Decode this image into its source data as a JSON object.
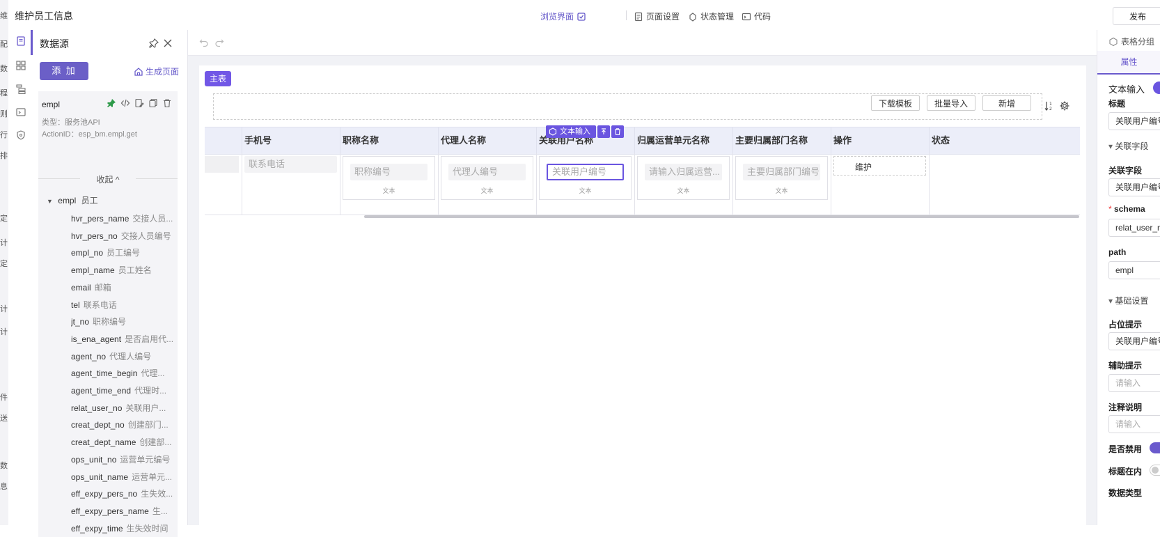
{
  "app": {
    "title": "维护员工信息",
    "publish": "发布"
  },
  "header": {
    "preview": "浏览界面",
    "page_settings": "页面设置",
    "state_mgmt": "状态管理",
    "code": "代码"
  },
  "edge_chars": [
    "维",
    "配",
    "数",
    "程",
    "则",
    "行",
    "排",
    "定",
    "计",
    "定",
    "计",
    "计",
    "件",
    "送",
    "数",
    "息"
  ],
  "datasource": {
    "title": "数据源",
    "add": "添 加",
    "generate": "生成页面",
    "item_name": "empl",
    "type_line": "类型：服务池API",
    "action_line": "ActionID：esp_bm.empl.get",
    "collapse": "收起 ^",
    "root": {
      "field": "empl",
      "desc": "员工"
    },
    "fields": [
      {
        "field": "hvr_pers_name",
        "desc": "交接人员..."
      },
      {
        "field": "hvr_pers_no",
        "desc": "交接人员编号"
      },
      {
        "field": "empl_no",
        "desc": "员工编号"
      },
      {
        "field": "empl_name",
        "desc": "员工姓名"
      },
      {
        "field": "email",
        "desc": "邮箱"
      },
      {
        "field": "tel",
        "desc": "联系电话"
      },
      {
        "field": "jt_no",
        "desc": "职称编号"
      },
      {
        "field": "is_ena_agent",
        "desc": "是否启用代..."
      },
      {
        "field": "agent_no",
        "desc": "代理人编号"
      },
      {
        "field": "agent_time_begin",
        "desc": "代理..."
      },
      {
        "field": "agent_time_end",
        "desc": "代理时..."
      },
      {
        "field": "relat_user_no",
        "desc": "关联用户..."
      },
      {
        "field": "creat_dept_no",
        "desc": "创建部门..."
      },
      {
        "field": "creat_dept_name",
        "desc": "创建部..."
      },
      {
        "field": "ops_unit_no",
        "desc": "运营单元编号"
      },
      {
        "field": "ops_unit_name",
        "desc": "运营单元..."
      },
      {
        "field": "eff_expy_pers_no",
        "desc": "生失效..."
      },
      {
        "field": "eff_expy_pers_name",
        "desc": "生..."
      },
      {
        "field": "eff_expy_time",
        "desc": "生失效时间"
      }
    ]
  },
  "canvas": {
    "main_tag": "主表",
    "buttons": {
      "download": "下载模板",
      "import": "批量导入",
      "add": "新增"
    },
    "columns": [
      "手机号",
      "职称名称",
      "代理人名称",
      "关联用户名称",
      "归属运营单元名称",
      "主要归属部门名称",
      "操作",
      "状态"
    ],
    "row": {
      "tel_placeholder": "联系电话",
      "jt_placeholder": "职称编号",
      "agent_placeholder": "代理人编号",
      "relat_placeholder": "关联用户编号",
      "ops_placeholder": "请输入归属运营...",
      "dept_placeholder": "主要归属部门编号",
      "cell_type": "文本",
      "action": "维护"
    },
    "selected_label": "文本输入"
  },
  "right_panel": {
    "group_tab": "表格分组",
    "tab": "属性",
    "component": "文本输入",
    "title_label": "标题",
    "title_value": "关联用户编号",
    "fold_related": "关联字段",
    "related_label": "关联字段",
    "related_value": "关联用户编号",
    "schema_label": "schema",
    "schema_value": "relat_user_no",
    "path_label": "path",
    "path_value": "empl",
    "fold_basic": "基础设置",
    "placeholder_label": "占位提示",
    "placeholder_value": "关联用户编号",
    "help_label": "辅助提示",
    "help_placeholder": "请输入",
    "note_label": "注释说明",
    "note_placeholder": "请输入",
    "disabled_label": "是否禁用",
    "title_inside_label": "标题在内",
    "datatype_label": "数据类型"
  }
}
